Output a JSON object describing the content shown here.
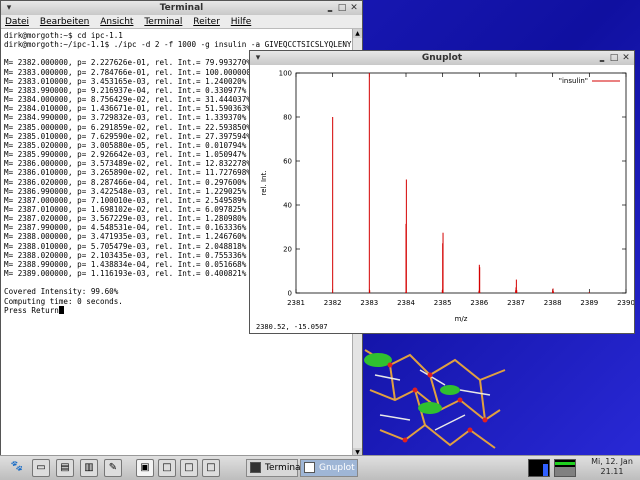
{
  "terminal": {
    "title": "Terminal",
    "menu": [
      "Datei",
      "Bearbeiten",
      "Ansicht",
      "Terminal",
      "Reiter",
      "Hilfe"
    ],
    "lines": [
      "dirk@morgoth:~$ cd ipc-1.1",
      "dirk@morgoth:~/ipc-1.1$ ./ipc -d 2 -f 1000 -g insulin -a GIVEQCCTSICSLYQLENYCN",
      "",
      "M= 2382.000000, p= 2.227626e-01, rel. Int.= 79.993270%",
      "M= 2383.000000, p= 2.784766e-01, rel. Int.= 100.000000%",
      "M= 2383.010000, p= 3.453165e-03, rel. Int.= 1.240020%",
      "M= 2383.990000, p= 9.216937e-04, rel. Int.= 0.330977%",
      "M= 2384.000000, p= 8.756429e-02, rel. Int.= 31.444037%",
      "M= 2384.010000, p= 1.436671e-01, rel. Int.= 51.590363%",
      "M= 2384.990000, p= 3.729832e-03, rel. Int.= 1.339370%",
      "M= 2385.000000, p= 6.291859e-02, rel. Int.= 22.593850%",
      "M= 2385.010000, p= 7.629590e-02, rel. Int.= 27.397594%",
      "M= 2385.020000, p= 3.005880e-05, rel. Int.= 0.010794%",
      "M= 2385.990000, p= 2.926642e-03, rel. Int.= 1.050947%",
      "M= 2386.000000, p= 3.573489e-02, rel. Int.= 12.832278%",
      "M= 2386.010000, p= 3.265890e-02, rel. Int.= 11.727698%",
      "M= 2386.020000, p= 8.287466e-04, rel. Int.= 0.297600%",
      "M= 2386.990000, p= 3.422548e-03, rel. Int.= 1.229025%",
      "M= 2387.000000, p= 7.100010e-03, rel. Int.= 2.549589%",
      "M= 2387.010000, p= 1.698102e-02, rel. Int.= 6.097825%",
      "M= 2387.020000, p= 3.567229e-03, rel. Int.= 1.280980%",
      "M= 2387.990000, p= 4.548531e-04, rel. Int.= 0.163336%",
      "M= 2388.000000, p= 3.471935e-03, rel. Int.= 1.246760%",
      "M= 2388.010000, p= 5.705479e-03, rel. Int.= 2.048818%",
      "M= 2388.020000, p= 2.103435e-03, rel. Int.= 0.755336%",
      "M= 2388.990000, p= 1.438834e-04, rel. Int.= 0.051668%",
      "M= 2389.000000, p= 1.116193e-03, rel. Int.= 0.400821%",
      "",
      "Covered Intensity: 99.60%",
      "Computing time: 0 seconds.",
      "Press Return"
    ]
  },
  "gnuplot": {
    "title": "Gnuplot",
    "status": "2380.52, -15.0507"
  },
  "chart_data": {
    "type": "bar",
    "title": "",
    "xlabel": "m/z",
    "ylabel": "rel. Int.",
    "xlim": [
      2381,
      2390
    ],
    "ylim": [
      0,
      100
    ],
    "xticks": [
      "2381",
      "2382",
      "2383",
      "2384",
      "2385",
      "2386",
      "2387",
      "2388",
      "2389",
      "2390"
    ],
    "yticks": [
      "0",
      "20",
      "40",
      "60",
      "80",
      "100"
    ],
    "legend": "top-right",
    "series": [
      {
        "name": "\"insulin\"",
        "color": "#d40000",
        "x": [
          2382.0,
          2383.0,
          2383.01,
          2383.99,
          2384.0,
          2384.01,
          2384.99,
          2385.0,
          2385.01,
          2385.02,
          2385.99,
          2386.0,
          2386.01,
          2386.02,
          2386.99,
          2387.0,
          2387.01,
          2387.02,
          2387.99,
          2388.0,
          2388.01,
          2388.02,
          2388.99,
          2389.0
        ],
        "y": [
          79.99,
          100.0,
          1.24,
          0.33,
          31.44,
          51.59,
          1.34,
          22.59,
          27.4,
          0.01,
          1.05,
          12.83,
          11.73,
          0.3,
          1.23,
          2.55,
          6.1,
          1.28,
          0.16,
          1.25,
          2.05,
          0.76,
          0.05,
          0.4
        ]
      }
    ]
  },
  "taskbar": {
    "tasks": [
      {
        "label": "Termina"
      },
      {
        "label": "Gnuplot"
      }
    ],
    "clock": {
      "date": "Mi, 12. Jan",
      "time": "21.11"
    }
  }
}
